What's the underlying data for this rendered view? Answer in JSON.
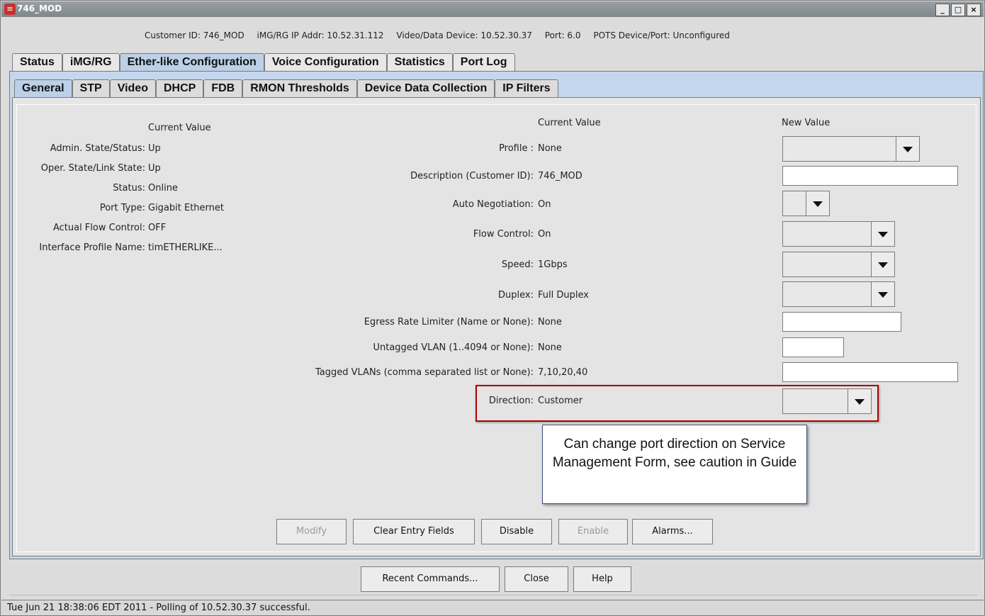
{
  "window": {
    "title": "746_MOD",
    "minimize_label": "_",
    "maximize_label": "□",
    "close_label": "×"
  },
  "info": {
    "customer_id": "Customer ID: 746_MOD",
    "img_ip": "iMG/RG IP Addr: 10.52.31.112",
    "video_data_device": "Video/Data Device: 10.52.30.37",
    "port": "Port: 6.0",
    "pots": "POTS Device/Port: Unconfigured"
  },
  "top_tabs": [
    "Status",
    "iMG/RG",
    "Ether-like Configuration",
    "Voice Configuration",
    "Statistics",
    "Port Log"
  ],
  "active_top_tab": "Ether-like Configuration",
  "sub_tabs": [
    "General",
    "STP",
    "Video",
    "DHCP",
    "FDB",
    "RMON Thresholds",
    "Device Data Collection",
    "IP Filters"
  ],
  "active_sub_tab": "General",
  "left_panel": {
    "header": "Current Value",
    "rows": [
      {
        "label": "Admin. State/Status:",
        "value": "Up"
      },
      {
        "label": "Oper. State/Link State:",
        "value": "Up"
      },
      {
        "label": "Status:",
        "value": "Online"
      },
      {
        "label": "Port Type:",
        "value": "Gigabit Ethernet"
      },
      {
        "label": "Actual Flow Control:",
        "value": "OFF"
      },
      {
        "label": "Interface Profile Name:",
        "value": "timETHERLIKE..."
      }
    ]
  },
  "right_panel": {
    "current_header": "Current Value",
    "new_header": "New Value",
    "rows": [
      {
        "label": "Profile :",
        "value": "None"
      },
      {
        "label": "Description (Customer ID):",
        "value": "746_MOD"
      },
      {
        "label": "Auto Negotiation:",
        "value": "On"
      },
      {
        "label": "Flow Control:",
        "value": "On"
      },
      {
        "label": "Speed:",
        "value": "1Gbps"
      },
      {
        "label": "Duplex:",
        "value": "Full Duplex"
      },
      {
        "label": "Egress Rate Limiter (Name or None):",
        "value": "None"
      },
      {
        "label": "Untagged VLAN (1..4094 or None):",
        "value": "None"
      },
      {
        "label": "Tagged VLANs (comma separated list or None):",
        "value": "7,10,20,40"
      },
      {
        "label": "Direction:",
        "value": "Customer"
      }
    ]
  },
  "callout": "Can change port direction on Service Management Form, see caution in Guide",
  "action_buttons": [
    "Modify",
    "Clear Entry Fields",
    "Disable",
    "Enable",
    "Alarms..."
  ],
  "bottom_buttons": [
    "Recent Commands...",
    "Close",
    "Help"
  ],
  "status_text": "Tue Jun 21 18:38:06 EDT 2011 - Polling of 10.52.30.37 successful."
}
